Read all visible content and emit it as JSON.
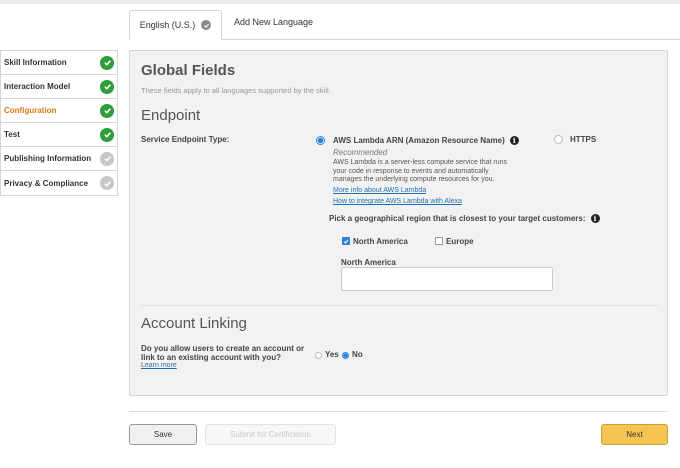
{
  "tabs": {
    "active_label": "English (U.S.)",
    "add_label": "Add New Language"
  },
  "sidebar": {
    "items": [
      {
        "label": "Skill Information",
        "status": "complete"
      },
      {
        "label": "Interaction Model",
        "status": "complete"
      },
      {
        "label": "Configuration",
        "status": "complete",
        "active": true
      },
      {
        "label": "Test",
        "status": "complete"
      },
      {
        "label": "Publishing Information",
        "status": "incomplete"
      },
      {
        "label": "Privacy & Compliance",
        "status": "incomplete"
      }
    ]
  },
  "global": {
    "title": "Global Fields",
    "subtitle": "These fields apply to all languages supported by the skill."
  },
  "endpoint": {
    "heading": "Endpoint",
    "type_label": "Service Endpoint Type:",
    "lambda_label": "AWS Lambda ARN (Amazon Resource Name)",
    "recommended": "Recommended",
    "desc_1": "AWS Lambda is a server-less compute service that runs",
    "desc_2": "your code in response to events and automatically",
    "desc_3": "manages the underlying compute resources for you.",
    "link_more": "More info about AWS Lambda",
    "link_integrate": "How to integrate AWS Lambda with Alexa",
    "https_label": "HTTPS",
    "selected": "lambda",
    "region_prompt": "Pick a geographical region that is closest to your target customers:",
    "region_na": "North America",
    "region_na_checked": true,
    "region_eu": "Europe",
    "region_eu_checked": false,
    "na_field_label": "North America",
    "na_field_value": ""
  },
  "account_linking": {
    "heading": "Account Linking",
    "question_1": "Do you allow users to create an account or",
    "question_2": "link to an existing account with you?",
    "learn_more": "Learn more",
    "yes": "Yes",
    "no": "No",
    "selected": "No"
  },
  "footer": {
    "save": "Save",
    "submit": "Submit for Certification",
    "next": "Next"
  },
  "colors": {
    "accent": "#e47911",
    "complete": "#2e9c3a",
    "incomplete": "#c8c8c8",
    "next_button": "#f5c453",
    "link": "#1f6fb4"
  }
}
